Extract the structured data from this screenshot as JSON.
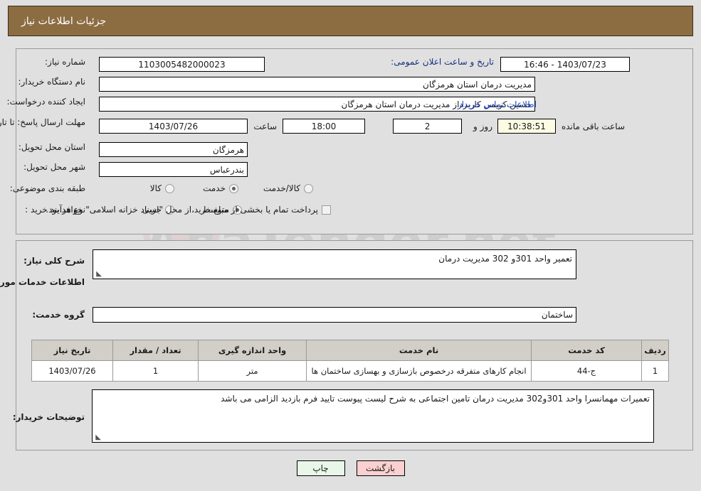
{
  "header": {
    "title": "جزئیات اطلاعات نیاز",
    "bar_color": "#8c6d42"
  },
  "watermark": {
    "text": "AnaTender.net"
  },
  "form": {
    "need_number": {
      "label": "شماره نیاز:",
      "value": "1103005482000023"
    },
    "announce_datetime": {
      "label": "تاریخ و ساعت اعلان عمومی:",
      "value": "1403/07/23 - 16:46"
    },
    "buyer_org": {
      "label": "نام دستگاه خریدار:",
      "value": "مدیریت درمان استان هرمزگان"
    },
    "requester": {
      "label": "ایجاد کننده درخواست:",
      "value": "حسین  کریمی کاربرداز مدیریت درمان استان هرمزگان"
    },
    "contact_link": "اطلاعات تماس خریدار",
    "deadline": {
      "label": "مهلت ارسال پاسخ: تا تاریخ:",
      "date": "1403/07/26",
      "hour_label": "ساعت",
      "hour": "18:00",
      "days": "2",
      "days_label": "روز و",
      "countdown": "10:38:51",
      "countdown_label": "ساعت باقی مانده"
    },
    "delivery_province": {
      "label": "استان محل تحویل:",
      "value": "هرمزگان"
    },
    "delivery_city": {
      "label": "شهر محل تحویل:",
      "value": "بندرعباس"
    },
    "category": {
      "label": "طبقه بندی موضوعی:",
      "options": [
        {
          "label": "کالا",
          "selected": false
        },
        {
          "label": "خدمت",
          "selected": true
        },
        {
          "label": "کالا/خدمت",
          "selected": false
        }
      ]
    },
    "purchase_type": {
      "label": "نوع فرآیند خرید :",
      "options": [
        {
          "label": "جزیی",
          "selected": false
        },
        {
          "label": "متوسط",
          "selected": true
        }
      ],
      "checkbox_label": "پرداخت تمام یا بخشی از مبلغ خرید،از محل \"اسناد خزانه اسلامی\" خواهد بود.",
      "checkbox_checked": false
    }
  },
  "details": {
    "need_description": {
      "label": "شرح کلی نیاز:",
      "value": "تعمیر واحد 301و 302 مدیریت درمان"
    },
    "services_heading": "اطلاعات خدمات مورد نیاز",
    "service_group": {
      "label": "گروه خدمت:",
      "value": "ساختمان"
    },
    "table": {
      "columns": [
        "ردیف",
        "کد خدمت",
        "نام خدمت",
        "واحد اندازه گیری",
        "تعداد / مقدار",
        "تاریخ نیاز"
      ],
      "rows": [
        {
          "row": "1",
          "code": "ج-44",
          "name": "انجام کارهای متفرقه درخصوص بازسازی و بهسازی ساختمان ها",
          "unit": "متر",
          "qty": "1",
          "date": "1403/07/26"
        }
      ]
    },
    "buyer_notes": {
      "label": "توضیحات خریدار:",
      "value": "تعمیرات مهمانسرا واحد 301و302 مدیریت درمان تامین اجتماعی به شرح لیست پیوست  تایید فرم بازدید الزامی می باشد"
    }
  },
  "footer": {
    "print_label": "چاپ",
    "back_label": "بازگشت"
  }
}
